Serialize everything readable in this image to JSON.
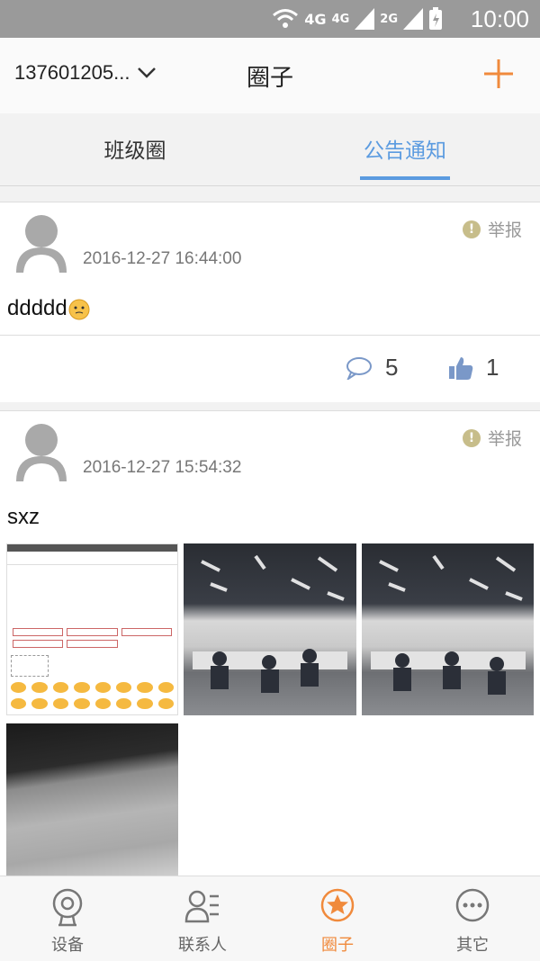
{
  "status_bar": {
    "time": "10:00",
    "net1": "4G",
    "net2": "4G",
    "net3": "2G"
  },
  "header": {
    "account": "137601205...",
    "title": "圈子"
  },
  "tabs": [
    {
      "label": "班级圈",
      "active": false
    },
    {
      "label": "公告通知",
      "active": true
    }
  ],
  "posts": [
    {
      "timestamp": "2016-12-27 16:44:00",
      "report_label": "举报",
      "text": "ddddd",
      "comments": "5",
      "likes": "1"
    },
    {
      "timestamp": "2016-12-27 15:54:32",
      "report_label": "举报",
      "text": "sxz"
    }
  ],
  "bottom_nav": [
    {
      "label": "设备",
      "icon": "camera-icon"
    },
    {
      "label": "联系人",
      "icon": "contacts-icon"
    },
    {
      "label": "圈子",
      "icon": "star-circle-icon",
      "active": true
    },
    {
      "label": "其它",
      "icon": "more-icon"
    }
  ],
  "colors": {
    "accent": "#f08a3c",
    "tab_active": "#5b9be0"
  }
}
